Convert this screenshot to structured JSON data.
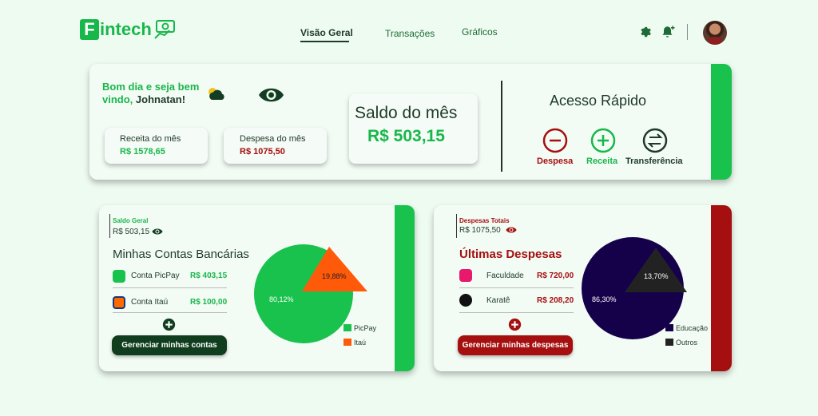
{
  "brand": {
    "name": "intech",
    "letter": "F"
  },
  "nav": {
    "visao_geral": "Visão Geral",
    "transacoes": "Transações",
    "graficos": "Gráficos"
  },
  "greeting": {
    "line": "Bom dia e seja bem vindo,",
    "name": "Johnatan!"
  },
  "receita": {
    "title": "Receita do mês",
    "value": "R$ 1578,65"
  },
  "despesa": {
    "title": "Despesa do mês",
    "value": "R$ 1075,50"
  },
  "saldo": {
    "title": "Saldo do mês",
    "value": "R$ 503,15"
  },
  "acesso": {
    "title": "Acesso Rápido",
    "despesa": "Despesa",
    "receita": "Receita",
    "transferencia": "Transferência"
  },
  "contas": {
    "balance_label": "Saldo Geral",
    "balance_value": "R$ 503,15",
    "title": "Minhas Contas Bancárias",
    "items": [
      {
        "name": "Conta PicPay",
        "value": "R$ 403,15"
      },
      {
        "name": "Conta Itaú",
        "value": "R$ 100,00"
      }
    ],
    "button": "Gerenciar minhas contas",
    "pie_labels": {
      "big": "80,12%",
      "small": "19,88%"
    },
    "legend": [
      "PicPay",
      "Itaú"
    ]
  },
  "despesas": {
    "balance_label": "Despesas Totais",
    "balance_value": "R$ 1075,50",
    "title": "Últimas Despesas",
    "items": [
      {
        "name": "Faculdade",
        "value": "R$ 720,00"
      },
      {
        "name": "Karatê",
        "value": "R$ 208,20"
      }
    ],
    "button": "Gerenciar minhas despesas",
    "pie_labels": {
      "big": "86,30%",
      "small": "13,70%"
    },
    "legend": [
      "Educação",
      "Outros"
    ]
  },
  "colors": {
    "green": "#18b74a",
    "dark_green": "#0f3d1e",
    "red": "#a50f0f",
    "orange": "#ff5a0a",
    "navy": "#15004a",
    "black": "#222222"
  }
}
